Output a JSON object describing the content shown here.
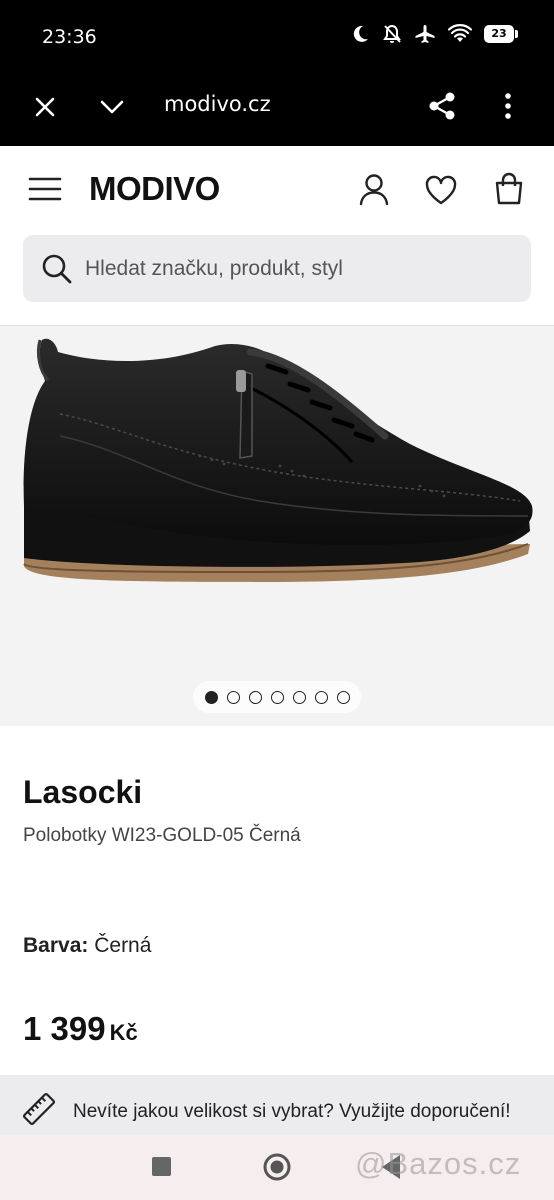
{
  "status_bar": {
    "time": "23:36",
    "battery": "23"
  },
  "browser": {
    "url": "modivo.cz"
  },
  "site": {
    "logo": "MODIVO"
  },
  "search": {
    "placeholder": "Hledat značku, produkt, styl"
  },
  "gallery": {
    "image_count": 7,
    "active_index": 0
  },
  "product": {
    "brand": "Lasocki",
    "name": "Polobotky WI23-GOLD-05 Černá",
    "color_label": "Barva:",
    "color_value": "Černá",
    "price_amount": "1 399",
    "price_currency": "Kč"
  },
  "size_banner": {
    "text": "Nevíte jakou velikost si vybrat? Využijte doporučení!"
  },
  "watermark": "@Bazos.cz",
  "icons": [
    "wifi-icon",
    "moon-icon",
    "bell-off-icon",
    "airplane-icon",
    "battery-icon",
    "close-icon",
    "chevron-down-icon",
    "share-icon",
    "more-icon",
    "menu-icon",
    "user-icon",
    "heart-icon",
    "bag-icon",
    "search-icon",
    "ruler-icon",
    "recents-icon",
    "home-icon",
    "back-icon"
  ]
}
